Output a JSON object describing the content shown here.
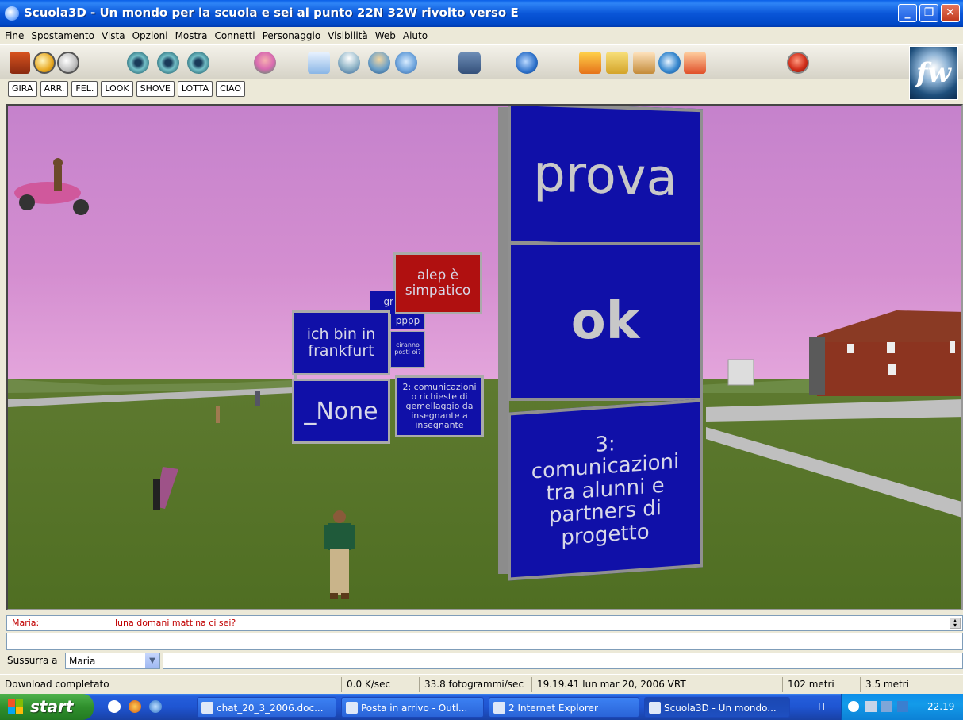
{
  "window": {
    "title": "Scuola3D - Un mondo per la scuola e sei al punto 22N 32W rivolto verso E",
    "minimize": "_",
    "maximize": "❐",
    "close": "✕"
  },
  "menu": [
    "Fine",
    "Spostamento",
    "Vista",
    "Opzioni",
    "Mostra",
    "Connetti",
    "Personaggio",
    "Visibilità",
    "Web",
    "Aiuto"
  ],
  "toolbar": {
    "icons": [
      "home-icon",
      "back-icon",
      "forward-icon",
      "eye-icon",
      "eye-icon",
      "eye-icon",
      "avatar-icon",
      "person-icon",
      "telegram-icon",
      "person-icon",
      "users-icon",
      "chat-icon",
      "internet-explorer-icon",
      "build-icon",
      "edit-icon",
      "tools-icon",
      "globe-icon",
      "help-icon",
      "exit-icon"
    ],
    "logo_text": "fw"
  },
  "gestures": [
    "GIRA",
    "ARR.",
    "FEL.",
    "LOOK",
    "SHOVE",
    "LOTTA",
    "CIAO"
  ],
  "world": {
    "signs": {
      "prova": "prova",
      "ok": "ok",
      "comunicazioni3": "3: comunicazioni tra alunni e partners di progetto",
      "alep": "alep è simpatico",
      "frankfurt": "ich bin in frankfurt",
      "none": "_None",
      "comunicazioni2": "2: comunicazioni o richieste di gemellaggio da insegnante a insegnante",
      "pppp": "pppp",
      "gr": "gr",
      "ciranno": "ciranno posti oi?"
    }
  },
  "chat": {
    "sender": "Maria:",
    "message": "luna domani mattina ci sei?",
    "input_value": ""
  },
  "whisper": {
    "label": "Sussurra a",
    "selected": "Maria",
    "input_value": ""
  },
  "status": {
    "message": "Download completato",
    "speed": "0.0 K/sec",
    "fps": "33.8 fotogrammi/sec",
    "datetime": "19.19.41 lun mar 20, 2006 VRT",
    "distance": "102 metri",
    "height": "3.5 metri"
  },
  "taskbar": {
    "start": "start",
    "buttons": [
      "chat_20_3_2006.doc...",
      "Posta in arrivo - Outl...",
      "2 Internet Explorer",
      "Scuola3D - Un mondo..."
    ],
    "language": "IT",
    "clock": "22.19"
  },
  "colors": {
    "sign_blue": "#1010a8",
    "sign_red": "#b01010",
    "sky_top": "#c678c6",
    "grass": "#5a7a28"
  }
}
